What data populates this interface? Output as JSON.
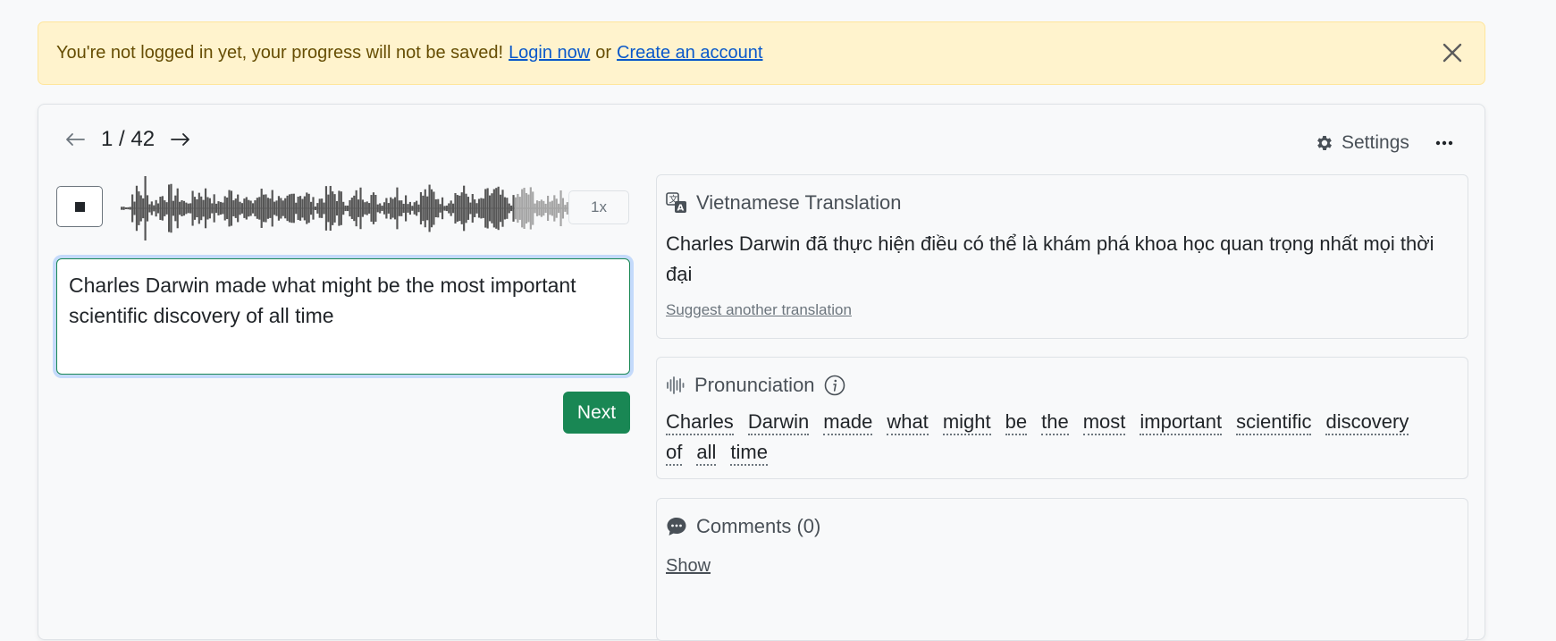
{
  "alert": {
    "message": "You're not logged in yet, your progress will not be saved!",
    "login_link": "Login now",
    "separator": "or",
    "create_link": "Create an account"
  },
  "pager": {
    "counter": "1 / 42",
    "prev_icon": "arrow-left-icon",
    "next_icon": "arrow-right-icon"
  },
  "toolbar": {
    "settings_label": "Settings",
    "more_icon": "ellipsis-icon"
  },
  "player": {
    "state": "playing",
    "progress": 0.83,
    "speed_label": "1x"
  },
  "answer": {
    "value": "Charles Darwin made what might be the most important scientific discovery of all time"
  },
  "next_button": "Next",
  "translation_panel": {
    "title": "Vietnamese Translation",
    "text": "Charles Darwin đã thực hiện điều có thể là khám phá khoa học quan trọng nhất mọi thời đại",
    "suggest_link": "Suggest another translation"
  },
  "pronunciation_panel": {
    "title": "Pronunciation",
    "words": [
      "Charles",
      "Darwin",
      "made",
      "what",
      "might",
      "be",
      "the",
      "most",
      "important",
      "scientific",
      "discovery",
      "of",
      "all",
      "time"
    ]
  },
  "comments_panel": {
    "title": "Comments (0)",
    "show_link": "Show"
  },
  "colors": {
    "alert_bg": "#fff3cd",
    "link": "#0a58ca",
    "primary_green": "#198754",
    "focus_ring": "#86b7fe"
  }
}
